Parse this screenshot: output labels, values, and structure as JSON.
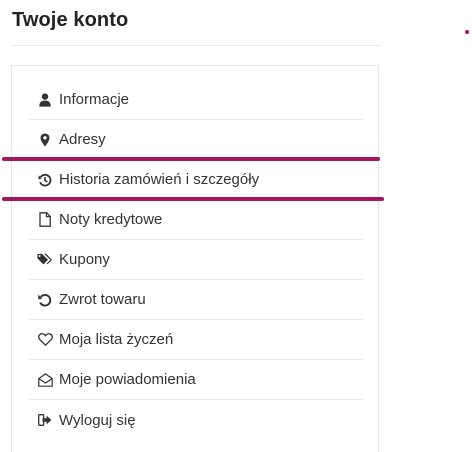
{
  "page": {
    "title": "Twoje konto",
    "accent_color": "#a51560"
  },
  "menu": {
    "items": [
      {
        "label": "Informacje",
        "icon": "user-icon"
      },
      {
        "label": "Adresy",
        "icon": "map-marker-icon"
      },
      {
        "label": "Historia zamówień i szczegóły",
        "icon": "history-icon",
        "highlighted": true
      },
      {
        "label": "Noty kredytowe",
        "icon": "file-icon"
      },
      {
        "label": "Kupony",
        "icon": "tags-icon"
      },
      {
        "label": "Zwrot towaru",
        "icon": "undo-icon"
      },
      {
        "label": "Moja lista życzeń",
        "icon": "heart-icon"
      },
      {
        "label": "Moje powiadomienia",
        "icon": "envelope-open-icon"
      },
      {
        "label": "Wyloguj się",
        "icon": "sign-out-icon"
      }
    ]
  }
}
